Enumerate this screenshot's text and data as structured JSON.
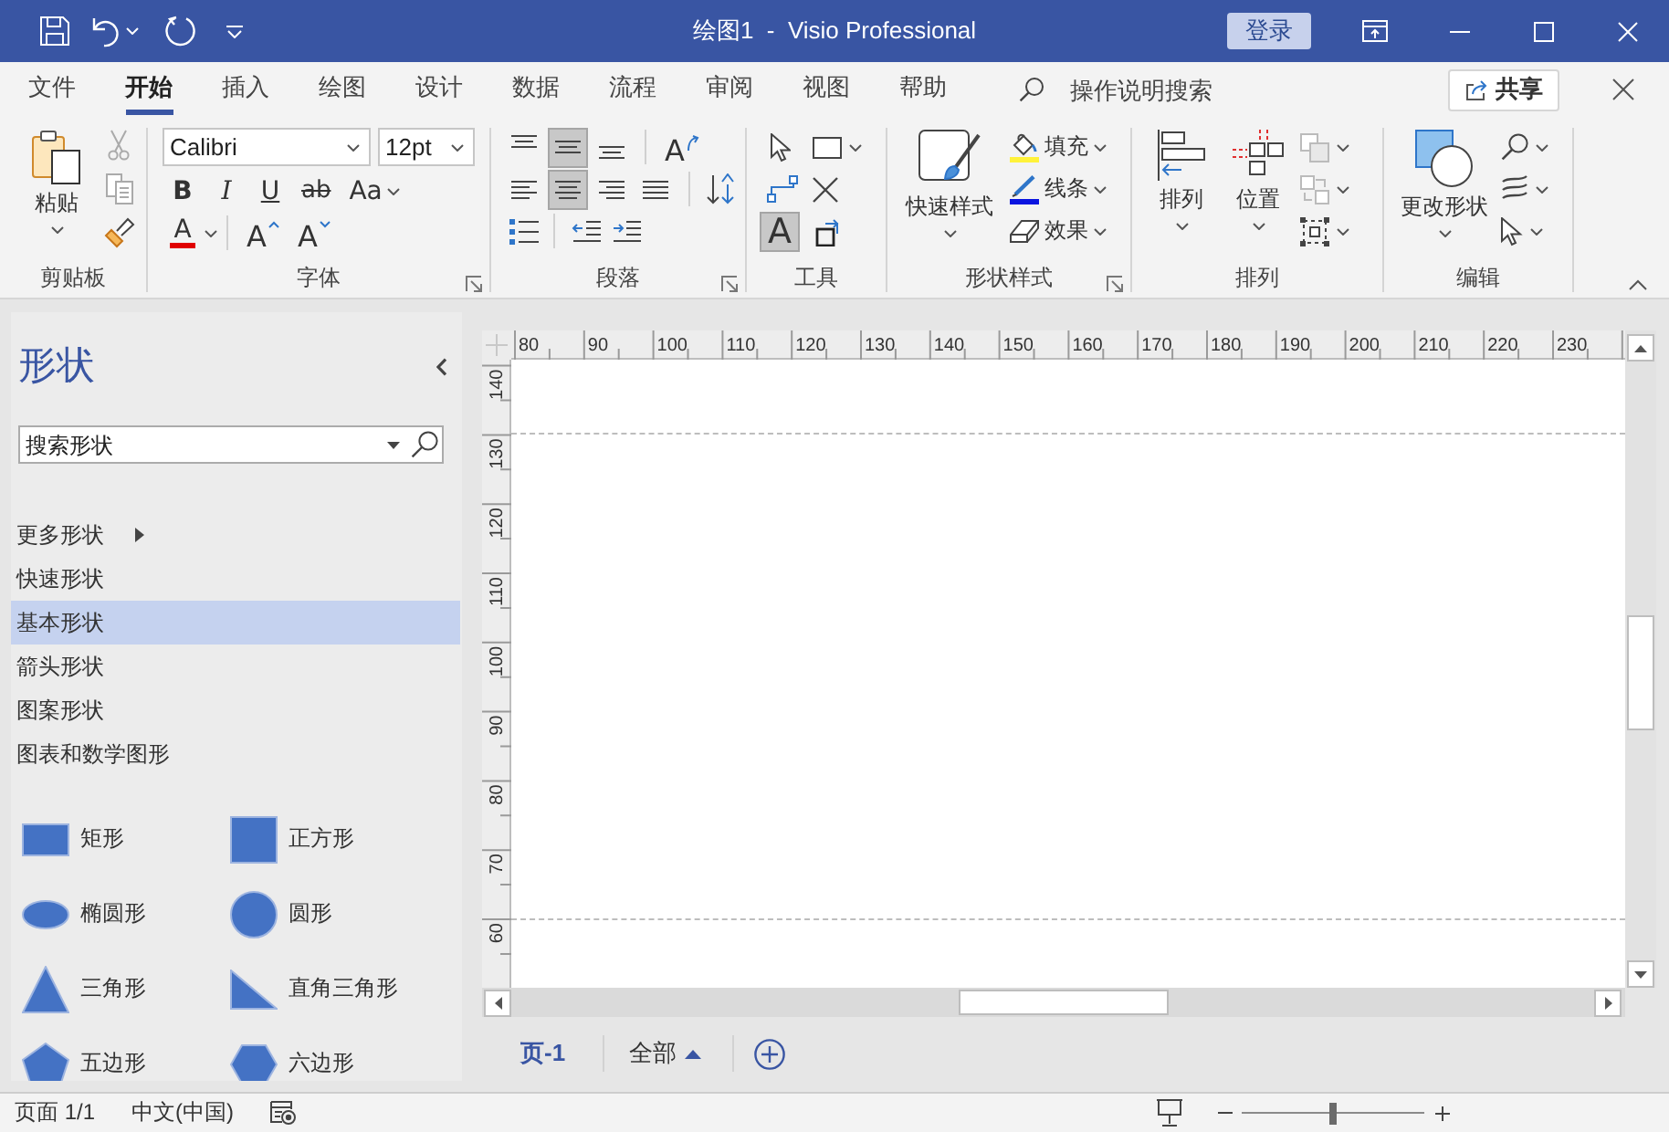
{
  "title_bar": {
    "title": "绘图1  -  Visio Professional",
    "sign_in": "登录"
  },
  "menu_tabs": [
    {
      "label": "文件",
      "selected": false
    },
    {
      "label": "开始",
      "selected": true
    },
    {
      "label": "插入",
      "selected": false
    },
    {
      "label": "绘图",
      "selected": false
    },
    {
      "label": "设计",
      "selected": false
    },
    {
      "label": "数据",
      "selected": false
    },
    {
      "label": "流程",
      "selected": false
    },
    {
      "label": "审阅",
      "selected": false
    },
    {
      "label": "视图",
      "selected": false
    },
    {
      "label": "帮助",
      "selected": false
    }
  ],
  "tell_me": {
    "placeholder": "操作说明搜索"
  },
  "share_button": {
    "label": "共享"
  },
  "ribbon": {
    "clipboard": {
      "label": "剪贴板",
      "paste": "粘贴"
    },
    "font": {
      "label": "字体",
      "font_name": "Calibri",
      "font_size": "12pt",
      "bold": "B",
      "italic": "I",
      "underline": "U",
      "strikethrough": "ab",
      "change_case": "Aa",
      "font_color": "A",
      "grow_font": "A",
      "shrink_font": "A"
    },
    "paragraph": {
      "label": "段落",
      "vertical_align": [
        {
          "kind": "top",
          "selected": false
        },
        {
          "kind": "middle",
          "selected": true
        },
        {
          "kind": "bottom",
          "selected": false
        }
      ],
      "rotate_text": "A",
      "horizontal_align": [
        {
          "kind": "left",
          "selected": false
        },
        {
          "kind": "center",
          "selected": true
        },
        {
          "kind": "right",
          "selected": false
        },
        {
          "kind": "justify",
          "selected": false
        }
      ]
    },
    "tools": {
      "label": "工具",
      "items": [
        {
          "kind": "pointer",
          "selected": false
        },
        {
          "kind": "rectangle",
          "selected": false
        },
        {
          "kind": "connector",
          "selected": false
        },
        {
          "kind": "connection-point",
          "selected": false
        },
        {
          "kind": "text",
          "label": "A",
          "selected": true
        },
        {
          "kind": "text-block",
          "selected": false
        }
      ]
    },
    "shape_styles": {
      "label": "形状样式",
      "quick_styles": "快速样式",
      "fill": "填充",
      "line": "线条",
      "effects": "效果"
    },
    "arrange": {
      "label": "排列",
      "align": "排列",
      "position": "位置"
    },
    "editing": {
      "label": "编辑",
      "change_shape": "更改形状"
    }
  },
  "shapes_panel": {
    "title": "形状",
    "search": {
      "placeholder": "搜索形状"
    },
    "stencils": [
      {
        "label": "更多形状",
        "kind": "submenu",
        "selected": false
      },
      {
        "label": "快速形状",
        "kind": "stencil",
        "selected": false
      },
      {
        "label": "基本形状",
        "kind": "stencil",
        "selected": true
      },
      {
        "label": "箭头形状",
        "kind": "stencil",
        "selected": false
      },
      {
        "label": "图案形状",
        "kind": "stencil",
        "selected": false
      },
      {
        "label": "图表和数学图形",
        "kind": "stencil",
        "selected": false
      }
    ],
    "shapes": [
      {
        "kind": "rectangle",
        "label": "矩形"
      },
      {
        "kind": "square",
        "label": "正方形"
      },
      {
        "kind": "ellipse",
        "label": "椭圆形"
      },
      {
        "kind": "circle",
        "label": "圆形"
      },
      {
        "kind": "triangle",
        "label": "三角形"
      },
      {
        "kind": "right-triangle",
        "label": "直角三角形"
      },
      {
        "kind": "pentagon",
        "label": "五边形"
      },
      {
        "kind": "hexagon",
        "label": "六边形"
      }
    ]
  },
  "rulers": {
    "horizontal": [
      "80",
      "90",
      "100",
      "110",
      "120",
      "130",
      "140",
      "150",
      "160",
      "170",
      "180",
      "190",
      "200",
      "210",
      "220",
      "230"
    ],
    "vertical": [
      "140",
      "130",
      "120",
      "110",
      "100",
      "90",
      "80",
      "70",
      "60"
    ]
  },
  "page_tabs": {
    "pages": [
      {
        "label": "页-1",
        "selected": true
      }
    ],
    "all_pages": "全部"
  },
  "status_bar": {
    "page": "页面 1/1",
    "language": "中文(中国)",
    "zoom_slider": {
      "level": 0.5
    }
  }
}
